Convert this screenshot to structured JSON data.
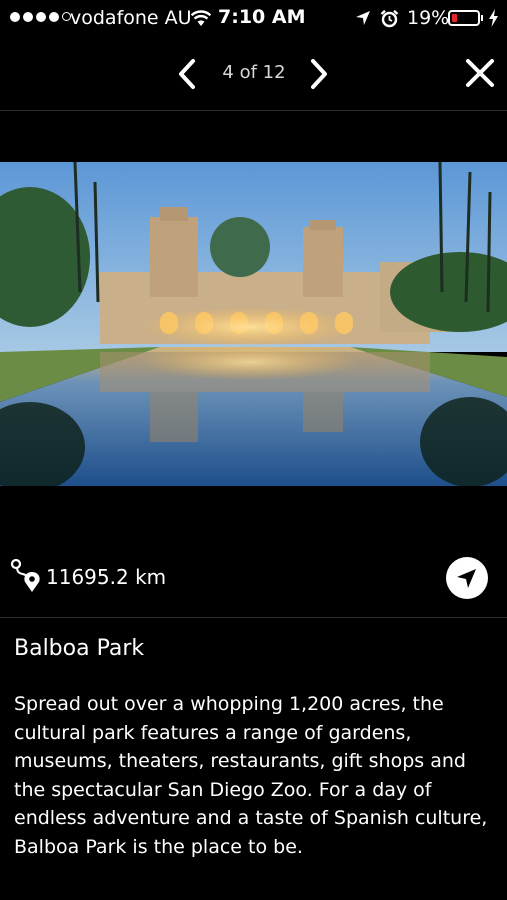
{
  "status_bar": {
    "carrier": "vodafone AU",
    "time": "7:10 AM",
    "battery_percent": "19%",
    "battery_level": 0.19,
    "battery_color": "#e8242b"
  },
  "nav": {
    "counter": "4 of 12",
    "prev_icon": "chevron-left-icon",
    "next_icon": "chevron-right-icon",
    "close_icon": "close-icon"
  },
  "place": {
    "distance": "11695.2 km",
    "name": "Balboa Park",
    "description": "Spread out over a whopping 1,200 acres, the cultural park features a range of gardens, museums, theaters, restaurants, gift shops and the spectacular San Diego Zoo. For a day of endless adventure and a taste of Spanish culture, Balboa Park is the place to be."
  }
}
